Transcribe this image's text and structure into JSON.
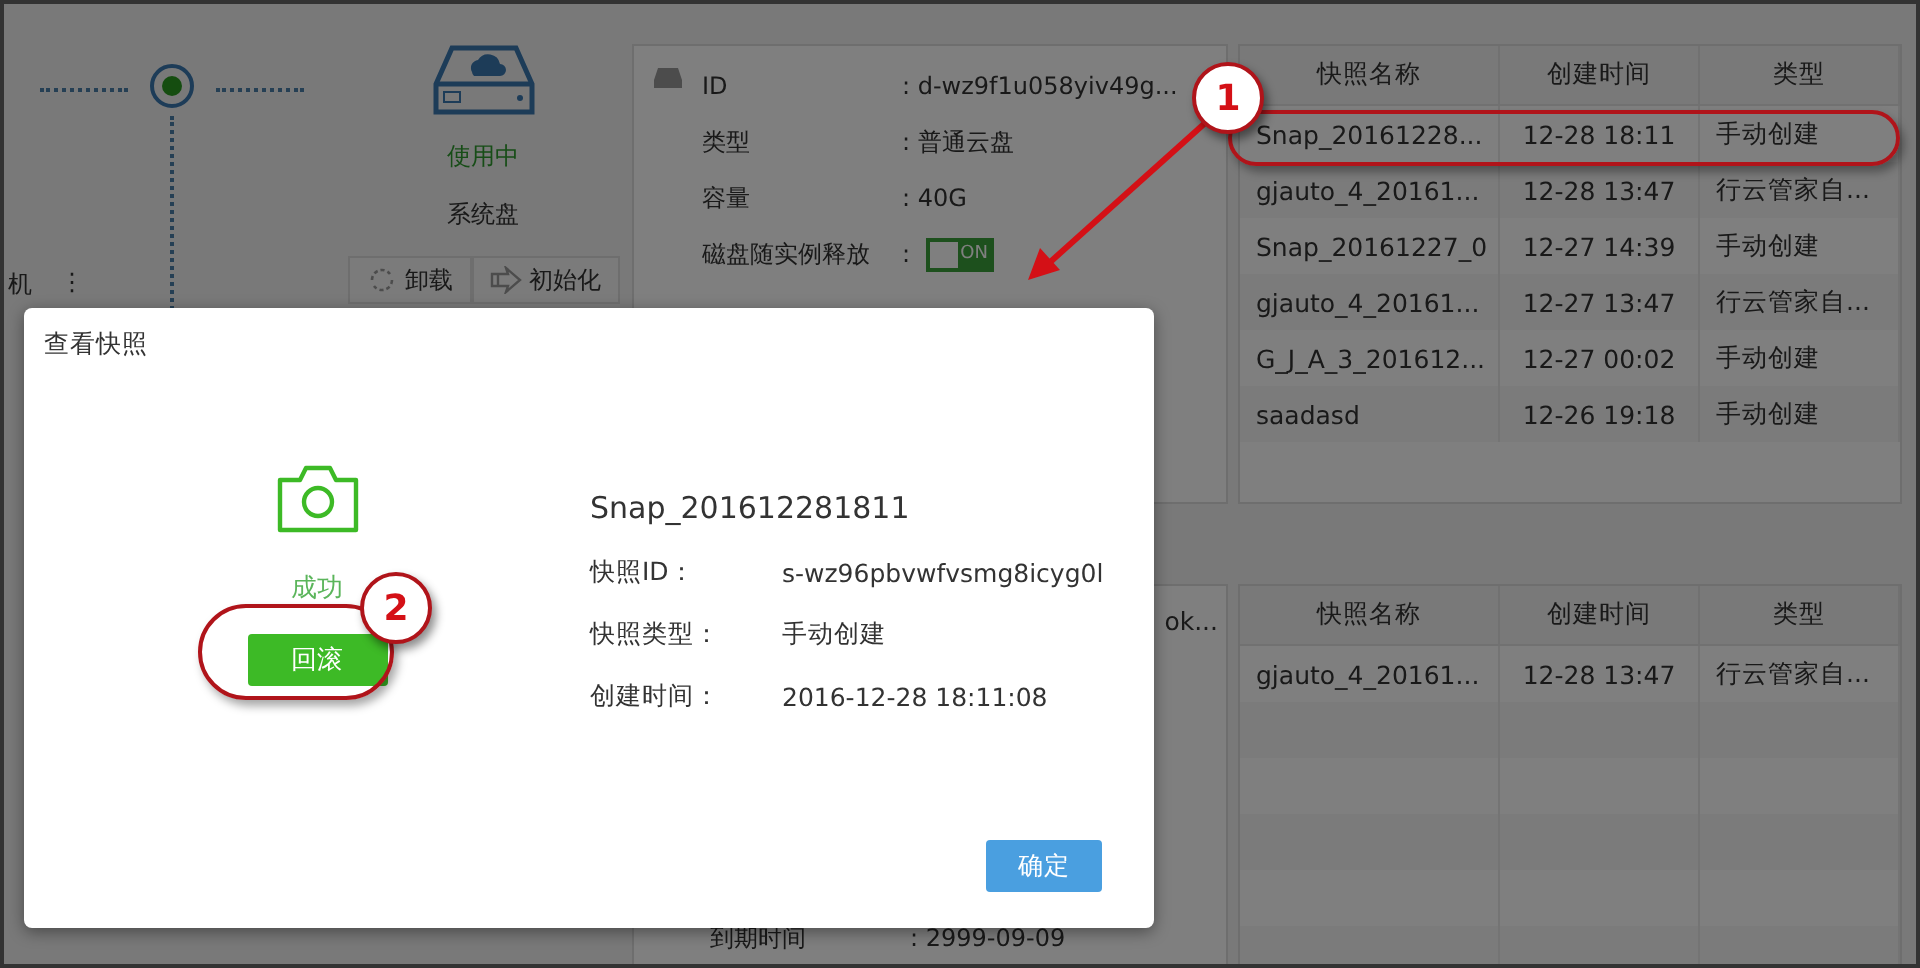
{
  "left": {
    "cut_text": "机",
    "more_glyph": "⋮",
    "status": "使用中",
    "disk_label": "系统盘",
    "actions": [
      "卸载",
      "初始化"
    ]
  },
  "disk_info": {
    "rows": [
      {
        "kind": "text",
        "label": "ID",
        "value": ": d-wz9f1u058yiv49g..."
      },
      {
        "kind": "text",
        "label": "类型",
        "value": ": 普通云盘"
      },
      {
        "kind": "text",
        "label": "容量",
        "value": ": 40G"
      },
      {
        "kind": "switch",
        "label": "磁盘随实例释放",
        "value": ":",
        "on": true,
        "switch_text": "ON"
      }
    ]
  },
  "snapshot_table": {
    "columns": [
      "快照名称",
      "创建时间",
      "类型"
    ],
    "rows": [
      [
        "Snap_20161228...",
        "12-28 18:11",
        "手动创建"
      ],
      [
        "gjauto_4_20161...",
        "12-28 13:47",
        "行云管家自..."
      ],
      [
        "Snap_20161227_0",
        "12-27 14:39",
        "手动创建"
      ],
      [
        "gjauto_4_20161...",
        "12-27 13:47",
        "行云管家自..."
      ],
      [
        "G_J_A_3_201612...",
        "12-27 00:02",
        "手动创建"
      ],
      [
        "saadasd",
        "12-26 19:18",
        "手动创建"
      ]
    ]
  },
  "lower_info": {
    "cut_text": "ok...",
    "rows": [
      {
        "label": "到期时间",
        "value": ": 2999-09-09"
      }
    ]
  },
  "lower_table": {
    "columns": [
      "快照名称",
      "创建时间",
      "类型"
    ],
    "rows": [
      [
        "gjauto_4_20161...",
        "12-28 13:47",
        "行云管家自..."
      ]
    ]
  },
  "dialog": {
    "title": "查看快照",
    "status": "成功",
    "rollback_button": "回滚",
    "snapshot_name": "Snap_201612281811",
    "fields": [
      {
        "label": "快照ID：",
        "value": "s-wz96pbvwfvsmg8icyg0l"
      },
      {
        "label": "快照类型：",
        "value": "手动创建"
      },
      {
        "label": "创建时间：",
        "value": "2016-12-28 18:11:08"
      }
    ],
    "ok_button": "确定"
  },
  "callouts": [
    "1",
    "2"
  ]
}
